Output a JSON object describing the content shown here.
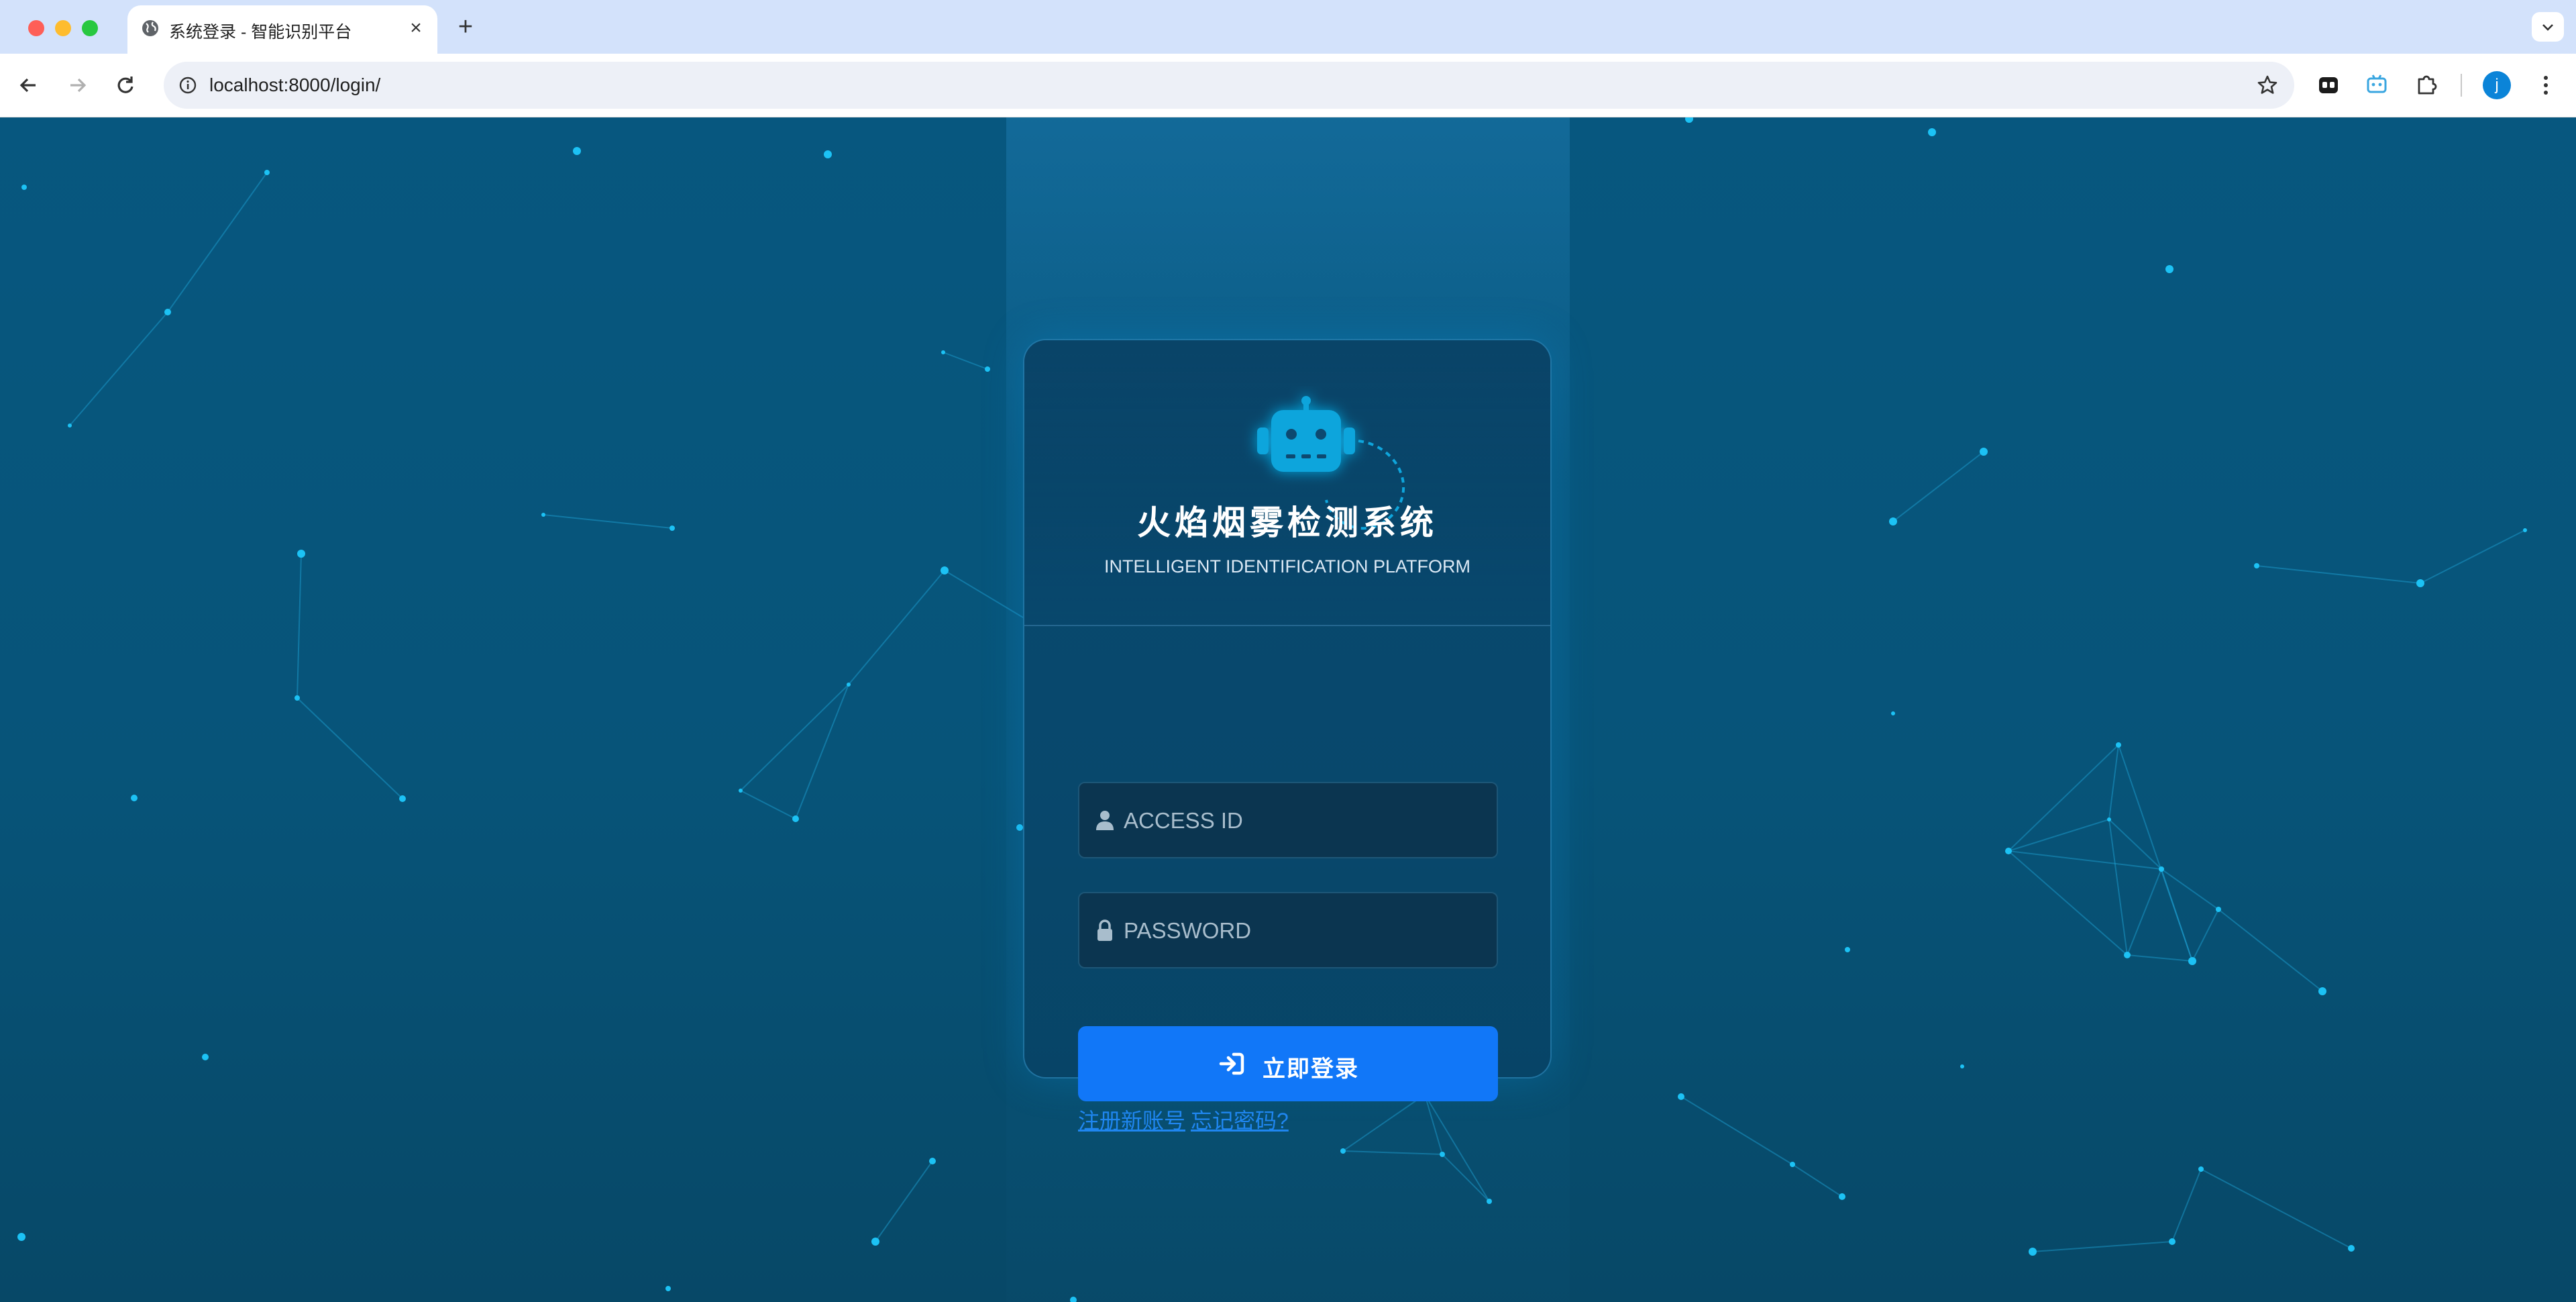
{
  "browser": {
    "tab_title": "系统登录 - 智能识别平台",
    "url": "localhost:8000/login/",
    "profile_initial": "j",
    "icons": [
      "globe-icon",
      "close-icon",
      "plus-icon",
      "chevron-down-icon",
      "back-icon",
      "forward-icon",
      "reload-icon",
      "info-icon",
      "star-icon",
      "extension-icon",
      "puzzle-icon",
      "kebab-icon"
    ]
  },
  "login": {
    "title": "火焰烟雾检测系统",
    "subtitle": "INTELLIGENT IDENTIFICATION PLATFORM",
    "username_placeholder": "ACCESS ID",
    "password_placeholder": "PASSWORD",
    "login_button_label": "立即登录",
    "register_link": "注册新账号",
    "forgot_link": "忘记密码?",
    "icons": [
      "robot-icon",
      "user-icon",
      "lock-icon",
      "sign-in-icon"
    ]
  },
  "colors": {
    "background_top": "#07577f",
    "background_bottom": "#074867",
    "accent_button": "#1177f8",
    "link": "#1f86f0",
    "robot": "#0ea5dc",
    "particle": "#1cc2f5"
  }
}
